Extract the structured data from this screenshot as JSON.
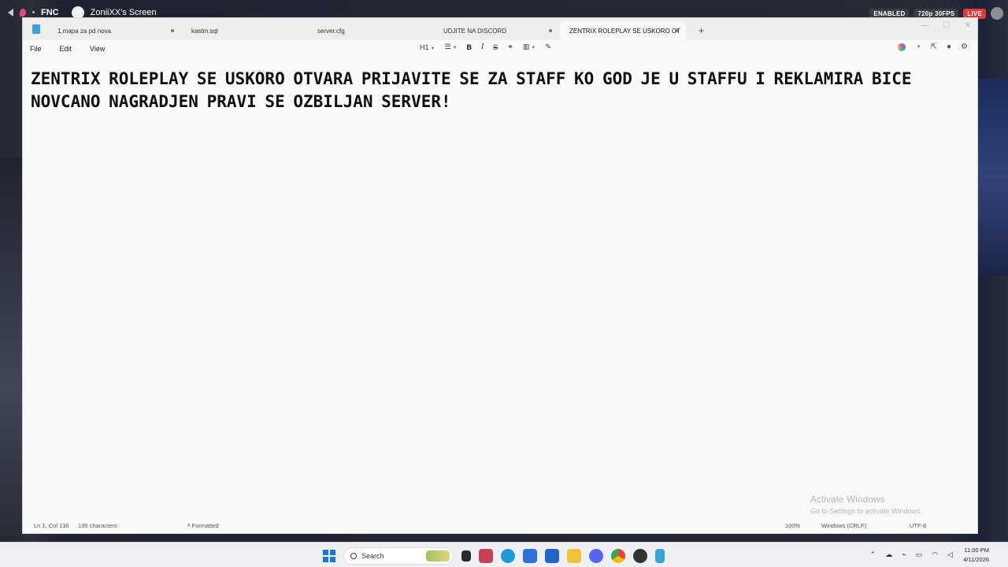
{
  "stream": {
    "server": "FNC",
    "title": "ZoniiXX's Screen",
    "badges": [
      "ENABLED",
      "720p 30FPS",
      "LIVE"
    ]
  },
  "window": {
    "tabs": [
      {
        "label": "1.mapa za pd nova",
        "modified": true
      },
      {
        "label": "kastm.sql",
        "modified": false
      },
      {
        "label": "server.cfg",
        "modified": false
      },
      {
        "label": "UDJITE NA DISCORD",
        "modified": true
      },
      {
        "label": "ZENTRIX ROLEPLAY SE USKORO OT",
        "modified": true,
        "active": true
      }
    ],
    "add_tab": "+",
    "menu": [
      "File",
      "Edit",
      "View"
    ],
    "toolbar": {
      "heading": "H1",
      "bold": "B",
      "italic": "I",
      "strike": "S"
    },
    "content": "ZENTRIX ROLEPLAY SE USKORO OTVARA PRIJAVITE SE ZA STAFF KO GOD JE U STAFFU I REKLAMIRA BICE NOVCANO NAGRADJEN PRAVI SE OZBILJAN SERVER!",
    "status": {
      "position": "Ln 1, Col 136",
      "chars": "135 characters",
      "format": "Formatted",
      "zoom": "100%",
      "line_ending": "Windows (CRLF)",
      "encoding": "UTF-8"
    },
    "watermark": {
      "title": "Activate Windows",
      "subtitle": "Go to Settings to activate Windows."
    }
  },
  "taskbar": {
    "search_placeholder": "Search",
    "time": "11:00 PM",
    "date": "4/11/2026"
  },
  "colors": {
    "live": "#e03b3b",
    "notepad_icon": "#3aa2d8",
    "win_blue": "#1677d4"
  }
}
